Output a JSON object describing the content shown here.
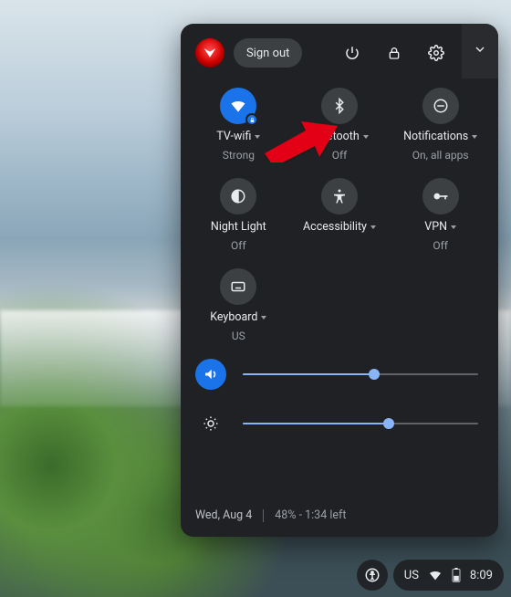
{
  "header": {
    "signout_label": "Sign out"
  },
  "tiles": {
    "wifi": {
      "label": "TV-wifi",
      "sub": "Strong"
    },
    "bluetooth": {
      "label": "Bluetooth",
      "sub": "Off"
    },
    "notifications": {
      "label": "Notifications",
      "sub": "On, all apps"
    },
    "nightlight": {
      "label": "Night Light",
      "sub": "Off"
    },
    "accessibility": {
      "label": "Accessibility",
      "sub": ""
    },
    "vpn": {
      "label": "VPN",
      "sub": "Off"
    },
    "keyboard": {
      "label": "Keyboard",
      "sub": "US"
    }
  },
  "sliders": {
    "volume_pct": 56,
    "brightness_pct": 62
  },
  "footer": {
    "date": "Wed, Aug 4",
    "battery": "48% - 1:34 left"
  },
  "shelf": {
    "ime": "US",
    "time": "8:09"
  }
}
